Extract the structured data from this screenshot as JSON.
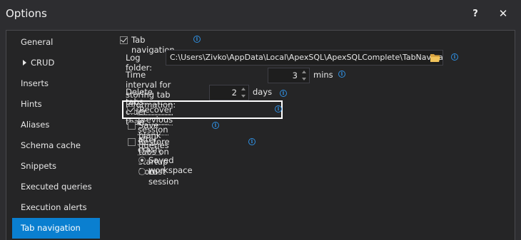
{
  "window": {
    "title": "Options",
    "help_label": "?",
    "close_label": "✕"
  },
  "sidebar": {
    "items": [
      {
        "label": "General"
      },
      {
        "label": "CRUD"
      },
      {
        "label": "Inserts"
      },
      {
        "label": "Hints"
      },
      {
        "label": "Aliases"
      },
      {
        "label": "Schema cache"
      },
      {
        "label": "Snippets"
      },
      {
        "label": "Executed queries"
      },
      {
        "label": "Execution alerts"
      },
      {
        "label": "Tab navigation"
      }
    ],
    "active": "Tab navigation"
  },
  "options": {
    "tab_navigation": {
      "label": "Tab navigation",
      "checked": true
    },
    "log_folder": {
      "label": "Log folder:",
      "value": "C:\\Users\\Zivko\\AppData\\Local\\ApexSQL\\ApexSQLComplete\\TabNavigation"
    },
    "time_interval": {
      "label": "Time interval for storing tab information:",
      "value": "3",
      "unit": "mins"
    },
    "delete_tabs": {
      "label": "Delete tabs older than:",
      "value": "2",
      "unit": "days"
    },
    "recover_session": {
      "label": "Recover previous session after crash",
      "checked": true
    },
    "save_blank": {
      "label": "Save blank queries",
      "checked": false
    },
    "restore_tabs": {
      "label": "Restore tabs on startup from",
      "checked": false,
      "choices": [
        {
          "label": "Saved workspace",
          "selected": true
        },
        {
          "label": "Last session",
          "selected": false
        }
      ]
    }
  },
  "colors": {
    "accent": "#0a7fd0",
    "info": "#2f8fe0",
    "background": "#2d2d30"
  }
}
